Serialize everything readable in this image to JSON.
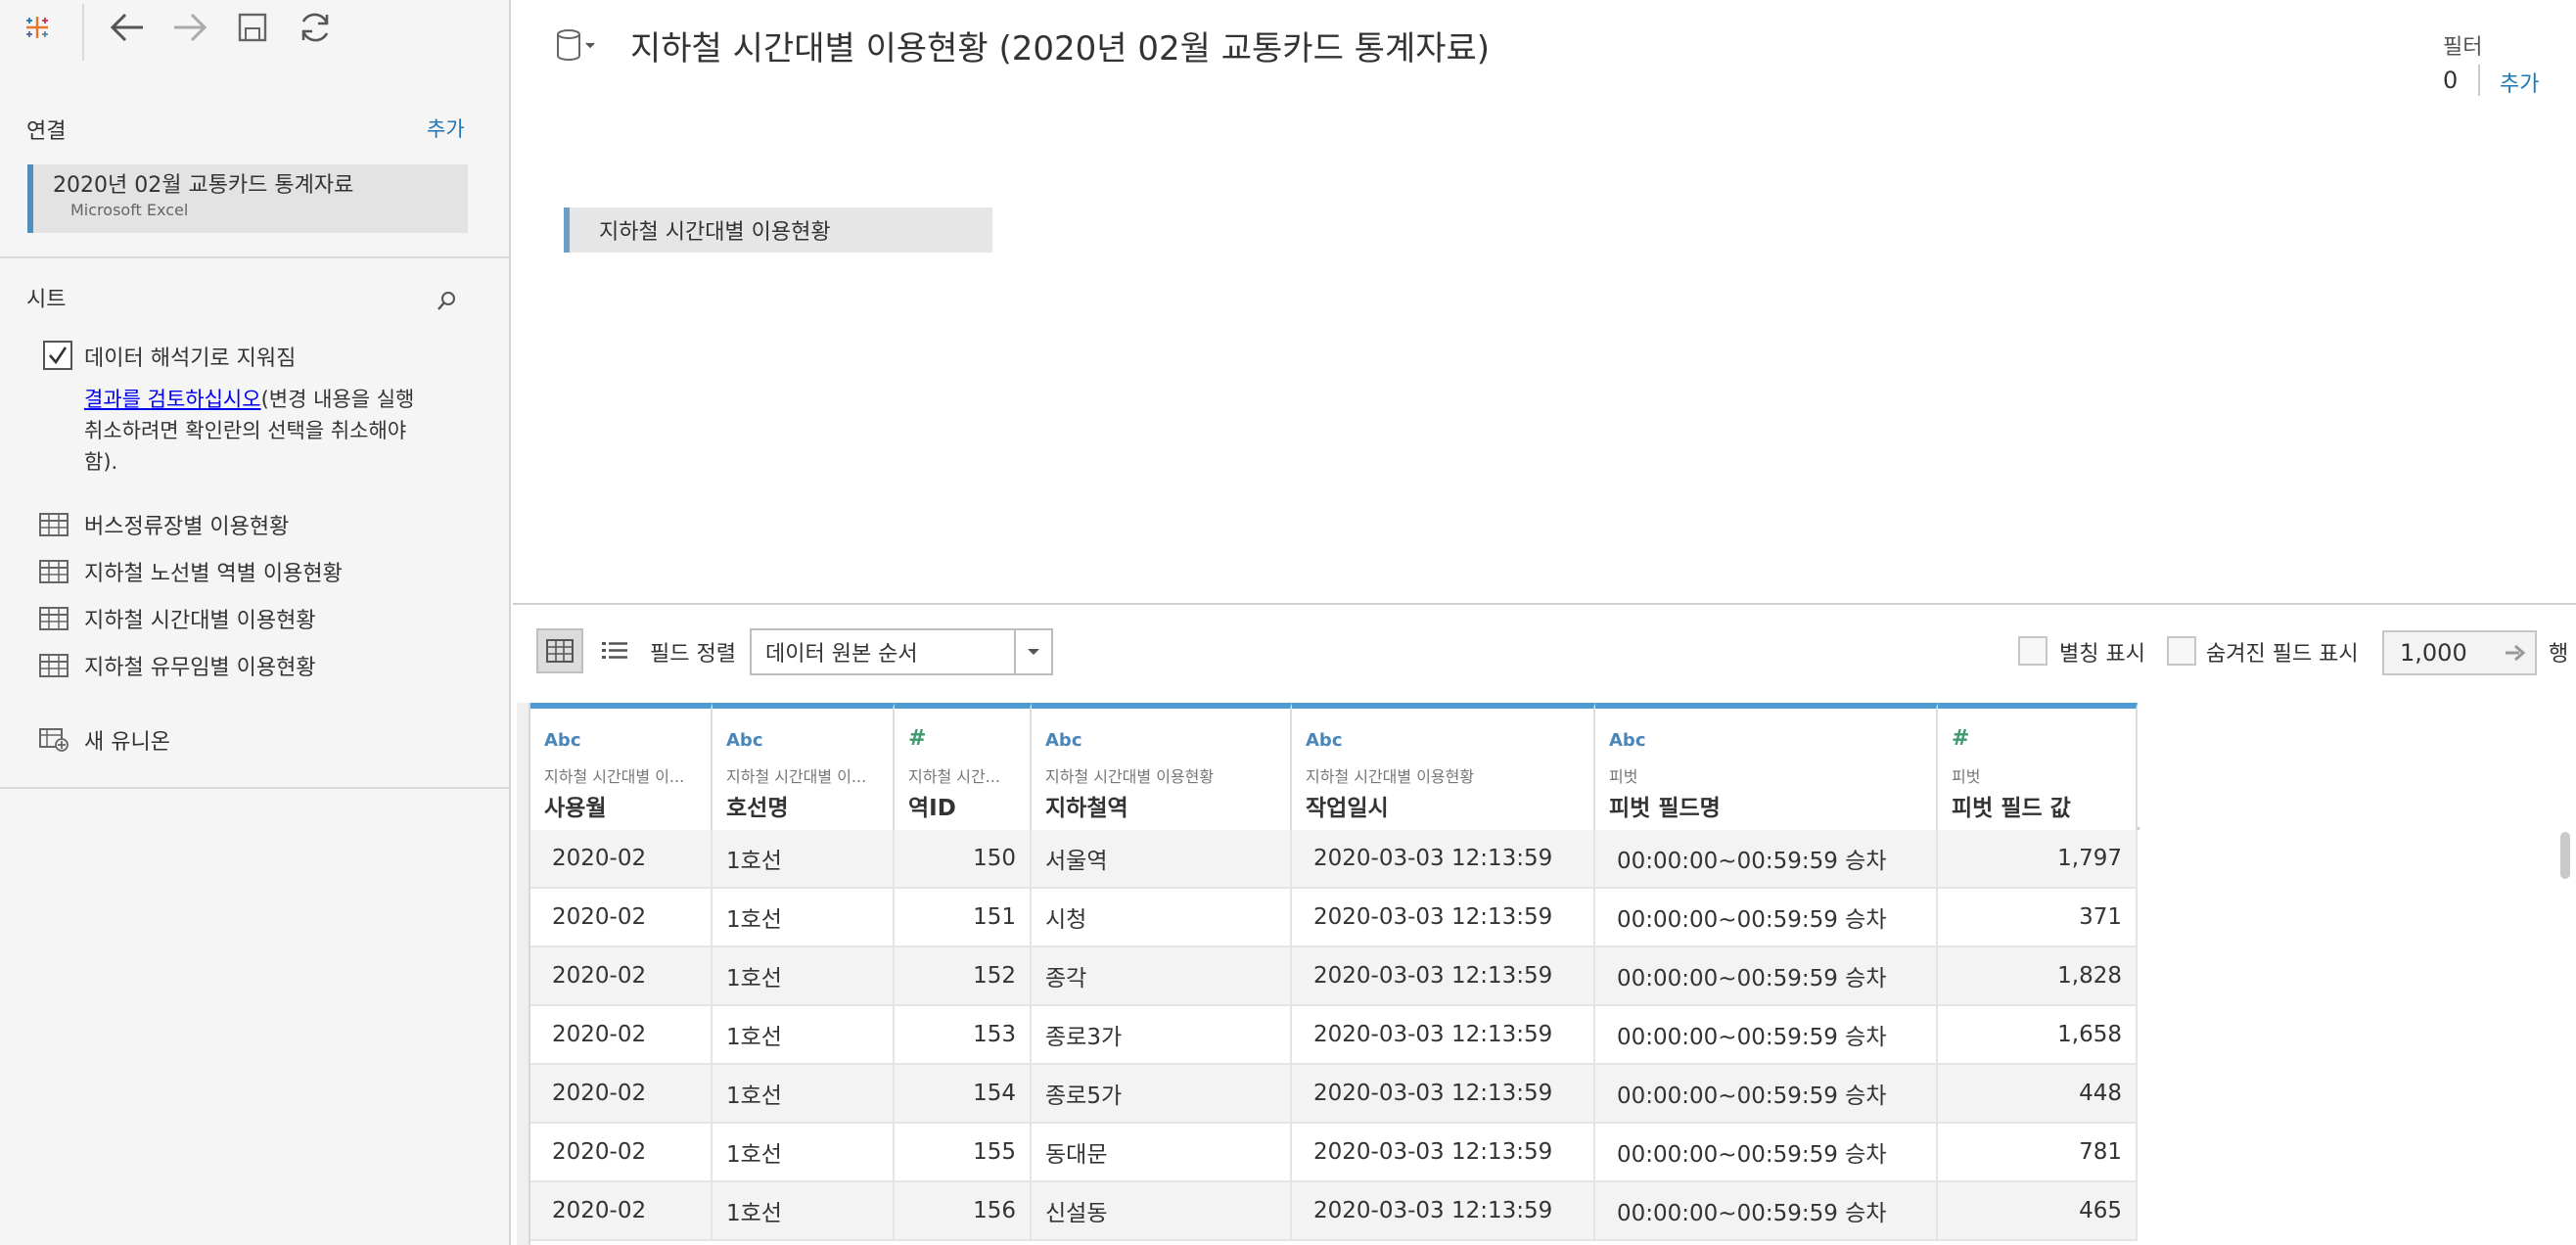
{
  "toolbar": {
    "logo_icon": "tableau-logo-icon",
    "back_icon": "arrow-left-icon",
    "forward_icon": "arrow-right-icon",
    "save_icon": "save-icon",
    "refresh_icon": "refresh-icon"
  },
  "sidebar": {
    "connections_heading": "연결",
    "connections_add": "추가",
    "connection": {
      "name": "2020년 02월  교통카드 통계자료",
      "type": "Microsoft Excel"
    },
    "sheets_heading": "시트",
    "interpreter": {
      "checked": true,
      "label": "데이터 해석기로 지워짐",
      "link_text": "결과를 검토하십시오",
      "note_line1": "(변경 내용을 실행",
      "note_line2": "취소하려면 확인란의 선택을 취소해야",
      "note_line3": "함)."
    },
    "sheets": [
      {
        "label": "버스정류장별 이용현황"
      },
      {
        "label": "지하철 노선별 역별 이용현황"
      },
      {
        "label": "지하철 시간대별 이용현황"
      },
      {
        "label": "지하철 유무임별 이용현황"
      }
    ],
    "new_union": "새 유니온"
  },
  "header": {
    "title": "지하철 시간대별 이용현황 (2020년 02월  교통카드 통계자료)",
    "filters_label": "필터",
    "filters_count": "0",
    "filters_add": "추가"
  },
  "canvas": {
    "table_name": "지하철 시간대별 이용현황"
  },
  "grid_toolbar": {
    "sort_label": "필드 정렬",
    "sort_value": "데이터 원본 순서",
    "show_aliases": "별칭 표시",
    "show_hidden": "숨겨진 필드 표시",
    "rows_value": "1,000",
    "rows_unit": "행"
  },
  "columns": [
    {
      "type": "Abc",
      "source": "지하철 시간대별 이...",
      "name": "사용월"
    },
    {
      "type": "Abc",
      "source": "지하철 시간대별 이...",
      "name": "호선명"
    },
    {
      "type": "#",
      "source": "지하철 시간...",
      "name": "역ID"
    },
    {
      "type": "Abc",
      "source": "지하철 시간대별 이용현황",
      "name": "지하철역"
    },
    {
      "type": "Abc",
      "source": "지하철 시간대별 이용현황",
      "name": "작업일시"
    },
    {
      "type": "Abc",
      "source": "피벗",
      "name": "피벗 필드명"
    },
    {
      "type": "#",
      "source": "피벗",
      "name": "피벗 필드 값"
    }
  ],
  "rows": [
    [
      "2020-02",
      "1호선",
      "150",
      "서울역",
      "2020-03-03 12:13:59",
      "00:00:00~00:59:59 승차",
      "1,797"
    ],
    [
      "2020-02",
      "1호선",
      "151",
      "시청",
      "2020-03-03 12:13:59",
      "00:00:00~00:59:59 승차",
      "371"
    ],
    [
      "2020-02",
      "1호선",
      "152",
      "종각",
      "2020-03-03 12:13:59",
      "00:00:00~00:59:59 승차",
      "1,828"
    ],
    [
      "2020-02",
      "1호선",
      "153",
      "종로3가",
      "2020-03-03 12:13:59",
      "00:00:00~00:59:59 승차",
      "1,658"
    ],
    [
      "2020-02",
      "1호선",
      "154",
      "종로5가",
      "2020-03-03 12:13:59",
      "00:00:00~00:59:59 승차",
      "448"
    ],
    [
      "2020-02",
      "1호선",
      "155",
      "동대문",
      "2020-03-03 12:13:59",
      "00:00:00~00:59:59 승차",
      "781"
    ],
    [
      "2020-02",
      "1호선",
      "156",
      "신설동",
      "2020-03-03 12:13:59",
      "00:00:00~00:59:59 승차",
      "465"
    ]
  ]
}
